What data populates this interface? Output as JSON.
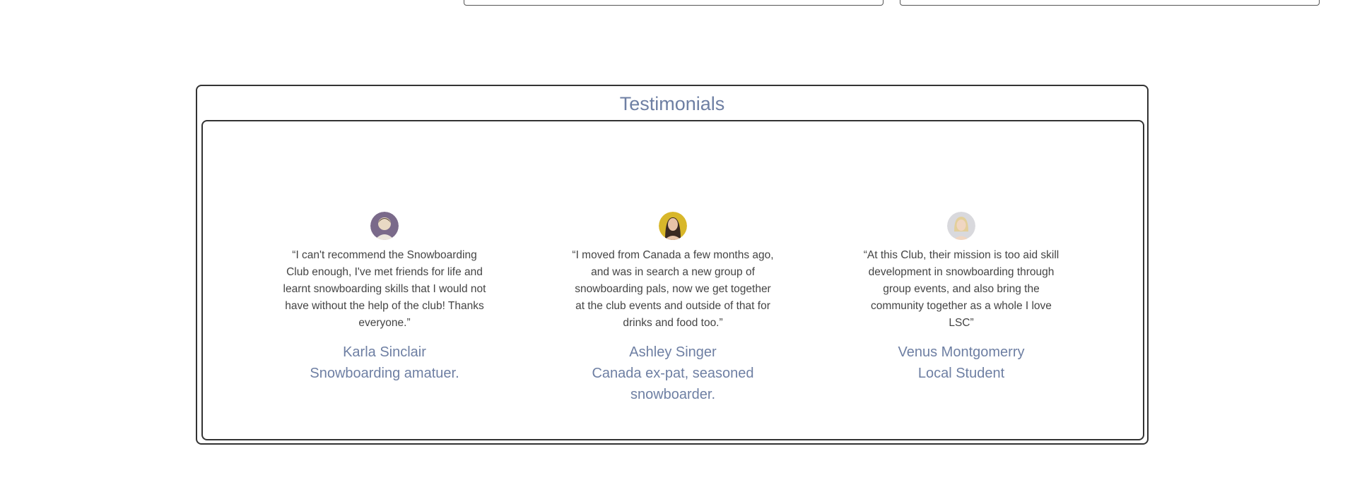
{
  "section": {
    "title": "Testimonials"
  },
  "testimonials": [
    {
      "quote": "“I can't recommend the Snowboarding Club enough, I've met friends for life and learnt snowboarding skills that I would not have without the help of the club! Thanks everyone.”",
      "name": "Karla Sinclair",
      "role": "Snowboarding amatuer.",
      "avatar_color": "#7a6a8a"
    },
    {
      "quote": "“I moved from Canada a few months ago, and was in search a new group of snowboarding pals, now we get together at the club events and outside of that for drinks and food too.”",
      "name": "Ashley Singer",
      "role": "Canada ex-pat, seasoned snowboarder.",
      "avatar_color": "#d8b72a"
    },
    {
      "quote": "“At this Club, their mission is too aid skill development in snowboarding through group events, and also bring the community together as a whole I love LSC”",
      "name": "Venus Montgomerry",
      "role": "Local Student",
      "avatar_color": "#d9d9dd"
    }
  ],
  "colors": {
    "accent": "#6e7fa3",
    "border": "#333333",
    "text": "#444444"
  }
}
